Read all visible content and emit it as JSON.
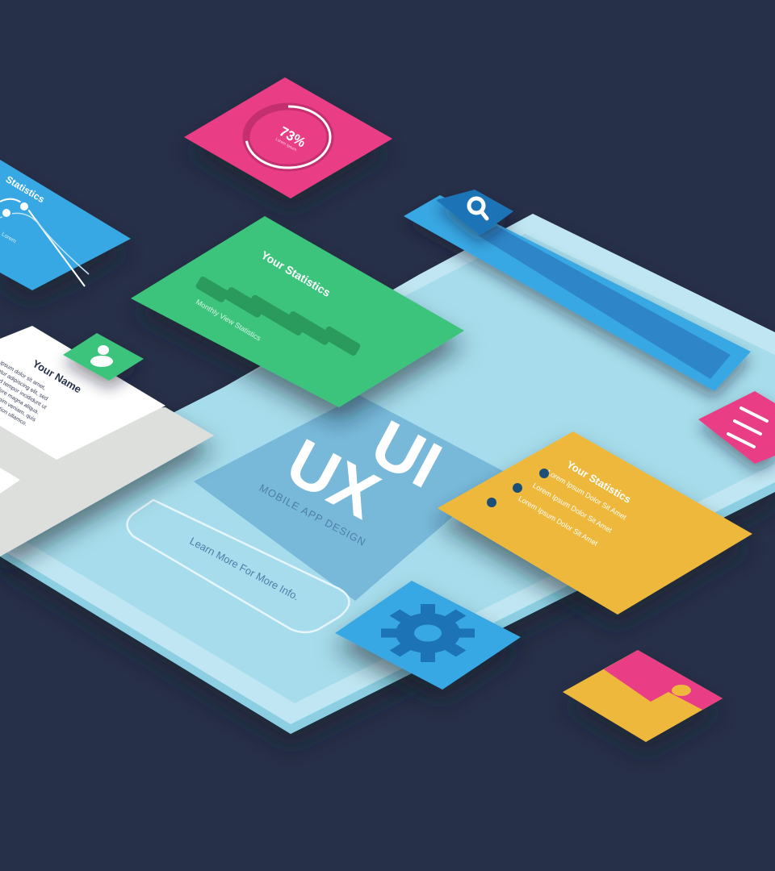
{
  "colors": {
    "background": "#273049",
    "device_light": "#BFE6F2",
    "device_screen": "#A6DCEB",
    "pink": "#E93D86",
    "green": "#3CC47C",
    "yellow": "#EDB83B",
    "blue": "#37A8E4",
    "navy_dot": "#1D4F78",
    "hero_panel": "#78B9DA"
  },
  "circle_card": {
    "percent": "73%",
    "progress_fraction": 0.73,
    "caption": "Lorem Ipsum"
  },
  "line_card": {
    "title": "Statistics",
    "caption": "Lorem"
  },
  "bar_card": {
    "title": "Your Statistics",
    "caption": "Monthly View Statistics",
    "bar_levels": [
      0.25,
      0.45,
      0.9,
      0.6,
      0.4
    ]
  },
  "profile_card": {
    "title": "Your Name",
    "body_lines": [
      "Lorem ipsum dolor sit amet,",
      "consectetur adipiscing elit, sed",
      "do eiusmod tempor incididunt ut",
      "labore et dolore magna aliqua.",
      "Ut enim ad minim veniam, quis",
      "nostrud exercitation ullamco."
    ]
  },
  "hero": {
    "line1": "UI",
    "line2": "UX",
    "subtitle": "MOBILE APP DESIGN"
  },
  "cta": {
    "label": "Learn More For More Info."
  },
  "list_card": {
    "title": "Your Statistics",
    "items": [
      "Lorem Ipsum Dolor Sit Amet",
      "Lorem Ipsum Dolor Sit Amet",
      "Lorem Ipsum Dolor Sit Amet"
    ]
  },
  "icons": {
    "search": "search-icon",
    "menu": "hamburger-menu-icon",
    "user": "user-icon",
    "gear": "gear-icon",
    "image": "image-icon"
  }
}
